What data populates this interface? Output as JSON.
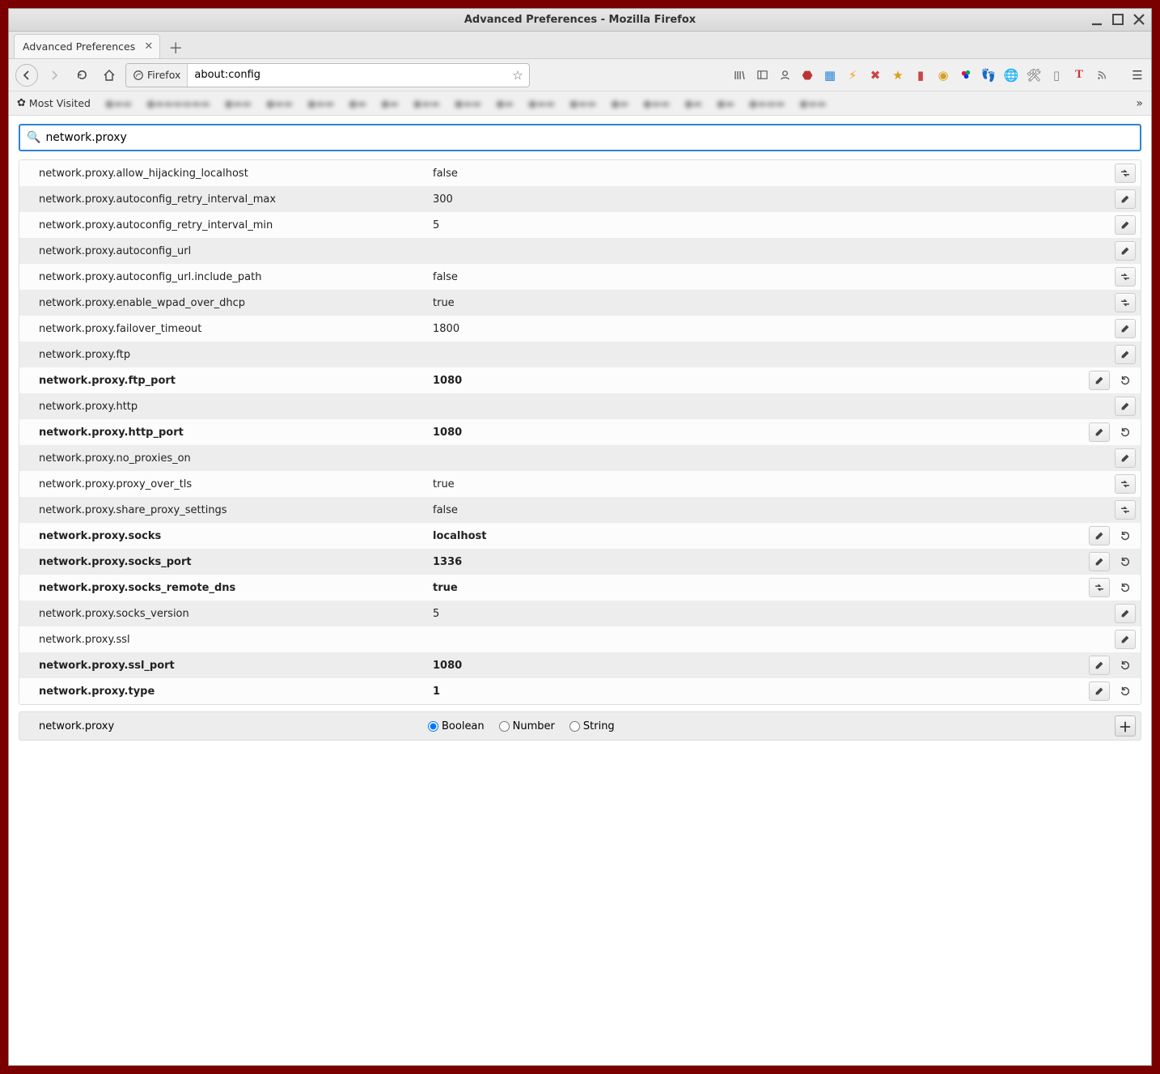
{
  "window": {
    "title": "Advanced Preferences - Mozilla Firefox"
  },
  "tab": {
    "title": "Advanced Preferences"
  },
  "urlbar": {
    "identity": "Firefox",
    "url": "about:config"
  },
  "bookmarks": {
    "most_visited": "Most Visited"
  },
  "search": {
    "value": "network.proxy"
  },
  "prefs": [
    {
      "name": "network.proxy.allow_hijacking_localhost",
      "value": "false",
      "action": "toggle",
      "modified": false
    },
    {
      "name": "network.proxy.autoconfig_retry_interval_max",
      "value": "300",
      "action": "edit",
      "modified": false
    },
    {
      "name": "network.proxy.autoconfig_retry_interval_min",
      "value": "5",
      "action": "edit",
      "modified": false
    },
    {
      "name": "network.proxy.autoconfig_url",
      "value": "",
      "action": "edit",
      "modified": false
    },
    {
      "name": "network.proxy.autoconfig_url.include_path",
      "value": "false",
      "action": "toggle",
      "modified": false
    },
    {
      "name": "network.proxy.enable_wpad_over_dhcp",
      "value": "true",
      "action": "toggle",
      "modified": false
    },
    {
      "name": "network.proxy.failover_timeout",
      "value": "1800",
      "action": "edit",
      "modified": false
    },
    {
      "name": "network.proxy.ftp",
      "value": "",
      "action": "edit",
      "modified": false
    },
    {
      "name": "network.proxy.ftp_port",
      "value": "1080",
      "action": "edit",
      "modified": true
    },
    {
      "name": "network.proxy.http",
      "value": "",
      "action": "edit",
      "modified": false
    },
    {
      "name": "network.proxy.http_port",
      "value": "1080",
      "action": "edit",
      "modified": true
    },
    {
      "name": "network.proxy.no_proxies_on",
      "value": "",
      "action": "edit",
      "modified": false
    },
    {
      "name": "network.proxy.proxy_over_tls",
      "value": "true",
      "action": "toggle",
      "modified": false
    },
    {
      "name": "network.proxy.share_proxy_settings",
      "value": "false",
      "action": "toggle",
      "modified": false
    },
    {
      "name": "network.proxy.socks",
      "value": "localhost",
      "action": "edit",
      "modified": true
    },
    {
      "name": "network.proxy.socks_port",
      "value": "1336",
      "action": "edit",
      "modified": true
    },
    {
      "name": "network.proxy.socks_remote_dns",
      "value": "true",
      "action": "toggle",
      "modified": true
    },
    {
      "name": "network.proxy.socks_version",
      "value": "5",
      "action": "edit",
      "modified": false
    },
    {
      "name": "network.proxy.ssl",
      "value": "",
      "action": "edit",
      "modified": false
    },
    {
      "name": "network.proxy.ssl_port",
      "value": "1080",
      "action": "edit",
      "modified": true
    },
    {
      "name": "network.proxy.type",
      "value": "1",
      "action": "edit",
      "modified": true
    }
  ],
  "addrow": {
    "name": "network.proxy",
    "types": {
      "boolean": "Boolean",
      "number": "Number",
      "string": "String"
    },
    "selected": "boolean"
  }
}
